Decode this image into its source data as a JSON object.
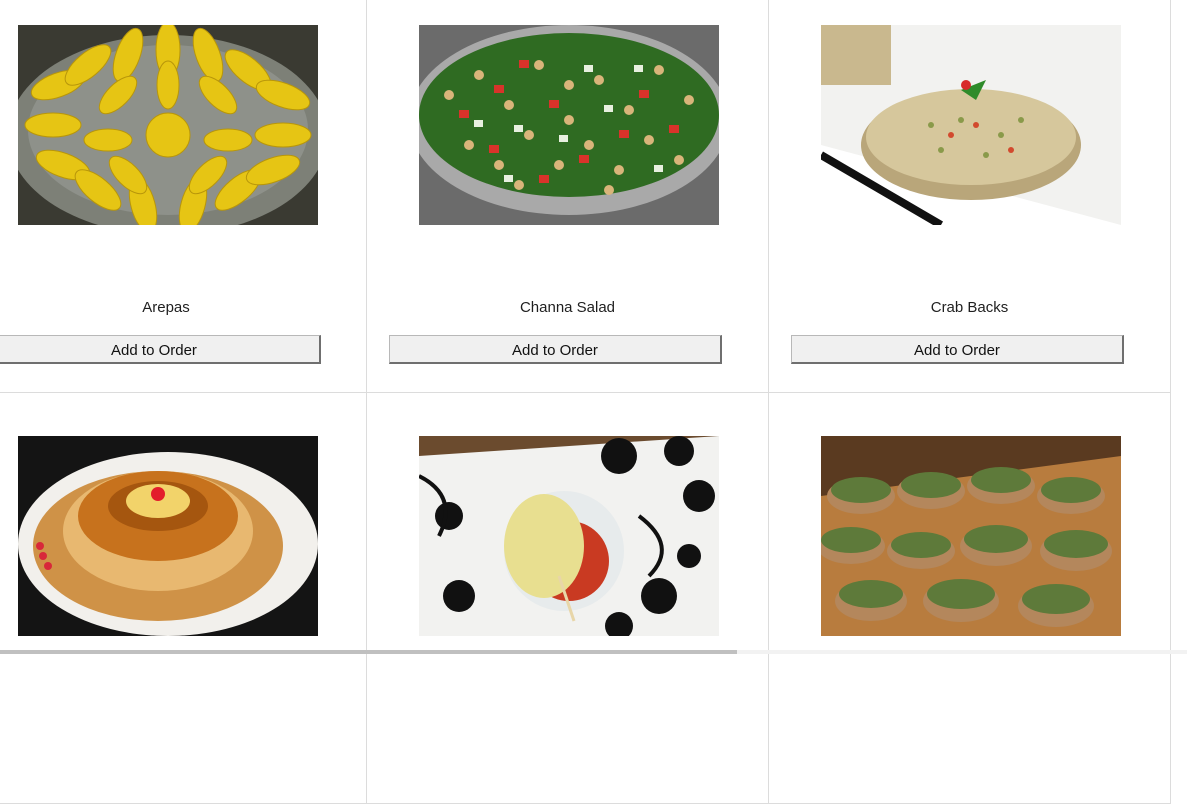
{
  "menu": {
    "button_label": "Add to Order",
    "items": [
      {
        "name": "Arepas",
        "image": "arepas-photo"
      },
      {
        "name": "Channa Salad",
        "image": "channa-salad-photo"
      },
      {
        "name": "Crab Backs",
        "image": "crab-backs-photo"
      },
      {
        "name": "",
        "image": "flan-photo"
      },
      {
        "name": "",
        "image": "pastry-cup-photo"
      },
      {
        "name": "",
        "image": "stuffed-mushrooms-photo"
      }
    ]
  },
  "colors": {
    "button_bg": "#f0f0f0",
    "border": "#dcdcdc"
  }
}
